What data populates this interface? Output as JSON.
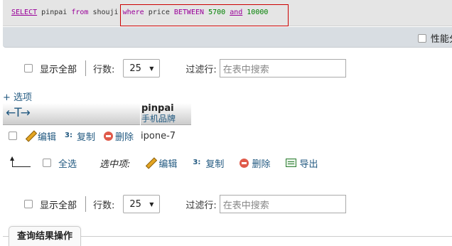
{
  "sql": {
    "select_kw": "SELECT",
    "column": "pinpai",
    "from_kw": "from",
    "table": "shouji",
    "where_kw": "where",
    "field": "price",
    "between_kw": "BETWEEN",
    "low": "5700",
    "and_kw": "and",
    "high": "10000"
  },
  "profiling_label": "性能分",
  "nav_top": {
    "show_all": "显示全部",
    "rows_label": "行数:",
    "rows_value": "25",
    "filter_label": "过滤行:",
    "filter_placeholder": "在表中搜索"
  },
  "options_link": "+ 选项",
  "table": {
    "arrows": "←T→",
    "columns": [
      {
        "name": "pinpai",
        "comment": "手机品牌"
      }
    ],
    "rows": [
      {
        "value": "ipone-7"
      }
    ],
    "row_actions": {
      "edit": "编辑",
      "copy": "复制",
      "delete": "删除"
    }
  },
  "bulk": {
    "select_all": "全选",
    "with_selected": "选中项:",
    "edit": "编辑",
    "copy": "复制",
    "delete": "删除",
    "export": "导出"
  },
  "nav_bottom": {
    "show_all": "显示全部",
    "rows_label": "行数:",
    "rows_value": "25",
    "filter_label": "过滤行:",
    "filter_placeholder": "在表中搜索"
  },
  "result_ops_tab": "查询结果操作",
  "colors": {
    "link": "#235a81",
    "keyword": "#990099",
    "number": "#008000",
    "highlight_box": "#cc0000"
  }
}
